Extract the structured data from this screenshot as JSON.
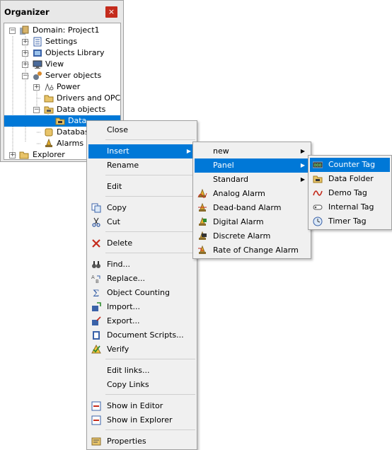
{
  "organizer": {
    "title": "Organizer",
    "close_glyph": "×",
    "tree": [
      {
        "label": "Domain: Project1",
        "icon": "domain-icon"
      },
      {
        "label": "Settings",
        "icon": "settings-icon"
      },
      {
        "label": "Objects Library",
        "icon": "library-icon"
      },
      {
        "label": "View",
        "icon": "monitor-icon"
      },
      {
        "label": "Server objects",
        "icon": "server-gear-icon"
      },
      {
        "label": "Power",
        "icon": "power-icon"
      },
      {
        "label": "Drivers and OPC",
        "icon": "folder-icon"
      },
      {
        "label": "Data objects",
        "icon": "data-folder-icon"
      },
      {
        "label": "Data",
        "icon": "data-tag-icon"
      },
      {
        "label": "Database",
        "icon": "database-icon"
      },
      {
        "label": "Alarms",
        "icon": "alarm-icon"
      },
      {
        "label": "Explorer",
        "icon": "folder-icon"
      }
    ]
  },
  "context_menu": {
    "items": [
      {
        "label": "Close",
        "icon": ""
      },
      {
        "label": "Insert",
        "icon": "",
        "submenu": true,
        "highlighted": true
      },
      {
        "label": "Rename",
        "icon": ""
      },
      {
        "label": "Edit",
        "icon": ""
      },
      {
        "label": "Copy",
        "icon": "copy-icon"
      },
      {
        "label": "Cut",
        "icon": "scissors-icon"
      },
      {
        "label": "Delete",
        "icon": "delete-x-icon"
      },
      {
        "label": "Find...",
        "icon": "binoculars-icon"
      },
      {
        "label": "Replace...",
        "icon": "replace-icon"
      },
      {
        "label": "Object Counting",
        "icon": "sigma-icon"
      },
      {
        "label": "Import...",
        "icon": "import-icon"
      },
      {
        "label": "Export...",
        "icon": "export-icon"
      },
      {
        "label": "Document Scripts...",
        "icon": "book-icon"
      },
      {
        "label": "Verify",
        "icon": "verify-icon"
      },
      {
        "label": "Edit links...",
        "icon": ""
      },
      {
        "label": "Copy Links",
        "icon": ""
      },
      {
        "label": "Show in Editor",
        "icon": "show-editor-icon"
      },
      {
        "label": "Show in Explorer",
        "icon": "show-explorer-icon"
      },
      {
        "label": "Properties",
        "icon": "properties-icon"
      }
    ]
  },
  "insert_menu": {
    "items": [
      {
        "label": "new",
        "submenu": true
      },
      {
        "label": "Panel",
        "submenu": true,
        "highlighted": true
      },
      {
        "label": "Standard",
        "submenu": true
      },
      {
        "label": "Analog Alarm",
        "icon": "analog-alarm-icon"
      },
      {
        "label": "Dead-band Alarm",
        "icon": "deadband-alarm-icon"
      },
      {
        "label": "Digital Alarm",
        "icon": "digital-alarm-icon"
      },
      {
        "label": "Discrete Alarm",
        "icon": "discrete-alarm-icon"
      },
      {
        "label": "Rate of Change Alarm",
        "icon": "rate-alarm-icon"
      }
    ]
  },
  "panel_menu": {
    "items": [
      {
        "label": "Counter Tag",
        "icon": "counter-tag-icon",
        "highlighted": true
      },
      {
        "label": "Data Folder",
        "icon": "data-folder-icon"
      },
      {
        "label": "Demo Tag",
        "icon": "demo-tag-icon"
      },
      {
        "label": "Internal Tag",
        "icon": "internal-tag-icon"
      },
      {
        "label": "Timer Tag",
        "icon": "timer-tag-icon"
      }
    ]
  },
  "colors": {
    "selection": "#0078d7",
    "close_button": "#c42b1c",
    "menu_bg": "#f0f0f0"
  }
}
